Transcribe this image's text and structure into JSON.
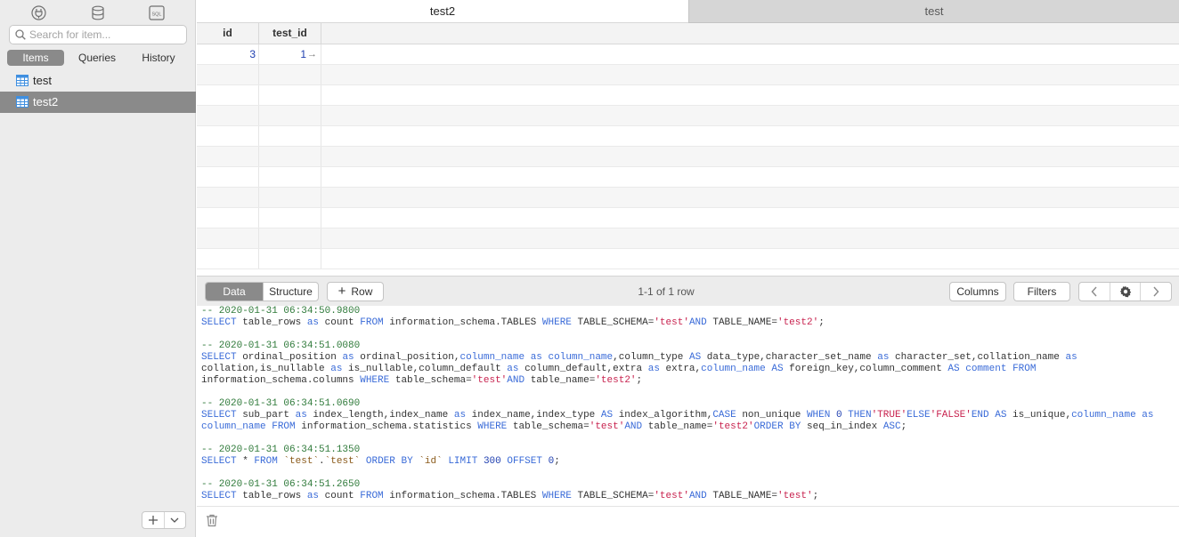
{
  "sidebar": {
    "top_icons": [
      "connection-icon",
      "database-icon",
      "sql-icon"
    ],
    "search_placeholder": "Search for item...",
    "tabs": [
      {
        "label": "Items",
        "active": true
      },
      {
        "label": "Queries",
        "active": false
      },
      {
        "label": "History",
        "active": false
      }
    ],
    "items": [
      {
        "label": "test",
        "selected": false
      },
      {
        "label": "test2",
        "selected": true
      }
    ],
    "footer": {
      "add_label": "+"
    }
  },
  "tabs": [
    {
      "label": "test2",
      "active": true
    },
    {
      "label": "test",
      "active": false
    }
  ],
  "grid": {
    "columns": [
      "id",
      "test_id"
    ],
    "rows": [
      {
        "id": "3",
        "test_id": "1",
        "fk_arrow": "→"
      }
    ]
  },
  "toolbar": {
    "view_tabs": [
      {
        "label": "Data",
        "active": true
      },
      {
        "label": "Structure",
        "active": false
      }
    ],
    "row_button": "Row",
    "row_plus": "+",
    "row_count": "1-1 of 1 row",
    "columns_button": "Columns",
    "filters_button": "Filters"
  },
  "log": {
    "entries": [
      {
        "comment": "-- 2020-01-31 06:34:50.9800",
        "sql": "SELECT table_rows as count FROM information_schema.TABLES WHERE TABLE_SCHEMA='test'AND TABLE_NAME='test2';"
      },
      {
        "comment": "-- 2020-01-31 06:34:51.0080",
        "sql": "SELECT ordinal_position as ordinal_position,column_name as column_name,column_type AS data_type,character_set_name as character_set,collation_name as collation,is_nullable as is_nullable,column_default as column_default,extra as extra,column_name AS foreign_key,column_comment AS comment FROM information_schema.columns WHERE table_schema='test'AND table_name='test2';"
      },
      {
        "comment": "-- 2020-01-31 06:34:51.0690",
        "sql": "SELECT sub_part as index_length,index_name as index_name,index_type AS index_algorithm,CASE non_unique WHEN 0 THEN'TRUE'ELSE'FALSE'END AS is_unique,column_name as column_name FROM information_schema.statistics WHERE table_schema='test'AND table_name='test2'ORDER BY seq_in_index ASC;"
      },
      {
        "comment": "-- 2020-01-31 06:34:51.1350",
        "sql": "SELECT * FROM `test`.`test` ORDER BY `id` LIMIT 300 OFFSET 0;"
      },
      {
        "comment": "-- 2020-01-31 06:34:51.2650",
        "sql": "SELECT table_rows as count FROM information_schema.TABLES WHERE TABLE_SCHEMA='test'AND TABLE_NAME='test';"
      }
    ]
  },
  "colors": {
    "selected_bg": "#8a8a8a",
    "sql_keyword": "#3a6bd8",
    "sql_string": "#c8234f",
    "sql_comment": "#2f7a3a",
    "table_icon": "#3f8fe0"
  }
}
